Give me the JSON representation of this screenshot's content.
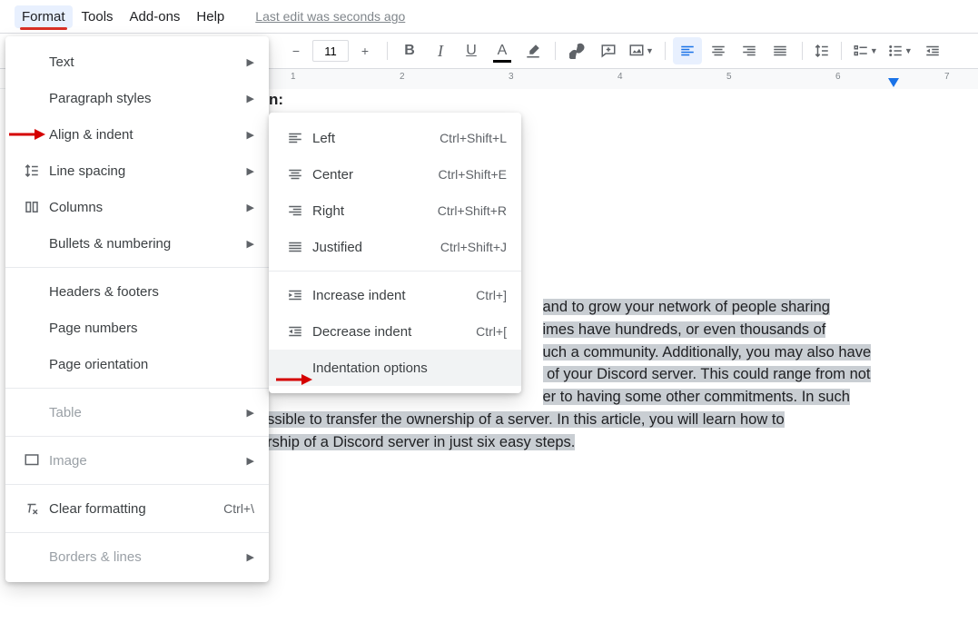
{
  "menubar": {
    "format": "Format",
    "tools": "Tools",
    "addons": "Add-ons",
    "help": "Help",
    "last_edit": "Last edit was seconds ago"
  },
  "toolbar": {
    "font_size": "11"
  },
  "ruler": {
    "ticks": [
      "1",
      "2",
      "3",
      "4",
      "5",
      "6",
      "7"
    ]
  },
  "format_menu": {
    "text": "Text",
    "paragraph_styles": "Paragraph styles",
    "align_indent": "Align & indent",
    "line_spacing": "Line spacing",
    "columns": "Columns",
    "bullets_numbering": "Bullets & numbering",
    "headers_footers": "Headers & footers",
    "page_numbers": "Page numbers",
    "page_orientation": "Page orientation",
    "table": "Table",
    "image": "Image",
    "clear_formatting": "Clear formatting",
    "clear_formatting_shortcut": "Ctrl+\\",
    "borders_lines": "Borders & lines"
  },
  "align_submenu": {
    "left": "Left",
    "left_sc": "Ctrl+Shift+L",
    "center": "Center",
    "center_sc": "Ctrl+Shift+E",
    "right": "Right",
    "right_sc": "Ctrl+Shift+R",
    "justified": "Justified",
    "justified_sc": "Ctrl+Shift+J",
    "increase_indent": "Increase indent",
    "increase_indent_sc": "Ctrl+]",
    "decrease_indent": "Decrease indent",
    "decrease_indent_sc": "Ctrl+[",
    "indentation_options": "Indentation options"
  },
  "doc": {
    "heading_fragment": "n:",
    "line1_a": "and to grow your network of people sharing",
    "line2_a": "imes have hundreds, or even thousands of",
    "line3_a": "uch a community. Additionally, you may also have",
    "line4_a": " of your Discord server. This could range from not",
    "line5_a": "er to having some other commitments. In such",
    "line6_a": "possible to transfer the ownership of a server. In this article, you will learn how to",
    "line7_a": "nership of a Discord server in just six easy steps."
  }
}
